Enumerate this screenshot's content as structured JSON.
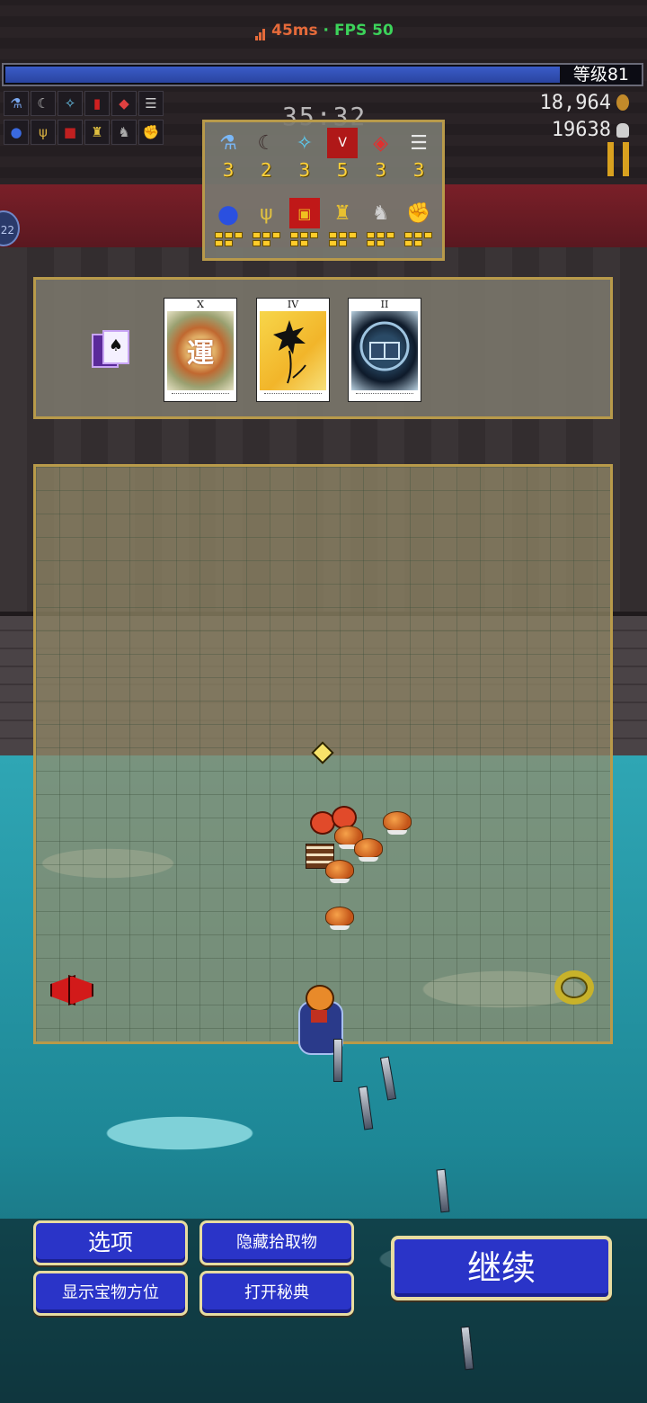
{
  "status": {
    "ping": "45ms",
    "separator": " · ",
    "fps": "FPS 50"
  },
  "xp": {
    "level_label": "等级81",
    "progress": 0.875
  },
  "timer": "35:32",
  "stats": {
    "gold": "18,964",
    "kills": "19638"
  },
  "left_badge": "22",
  "quick_icons": {
    "row1": [
      "flask-icon",
      "whip-icon",
      "wand-icon",
      "book-icon",
      "orb-icon",
      "knives-icon"
    ],
    "row2": [
      "blue-orb-icon",
      "candelabra-icon",
      "tome-icon",
      "crown-icon",
      "armor-icon",
      "gauntlet-icon"
    ]
  },
  "equipment": {
    "weapons": [
      {
        "icon": "holy-water-icon",
        "count": "3"
      },
      {
        "icon": "whip-icon",
        "count": "2"
      },
      {
        "icon": "magic-wand-icon",
        "count": "3"
      },
      {
        "icon": "king-bible-icon",
        "count": "5"
      },
      {
        "icon": "runetracer-icon",
        "count": "3"
      },
      {
        "icon": "knife-icon",
        "count": "3"
      }
    ],
    "passives": [
      {
        "icon": "blue-orb-icon",
        "level": 5
      },
      {
        "icon": "candelabrador-icon",
        "level": 5
      },
      {
        "icon": "empty-tome-icon",
        "level": 5
      },
      {
        "icon": "crown-icon",
        "level": 5
      },
      {
        "icon": "armor-icon",
        "level": 5
      },
      {
        "icon": "bracer-icon",
        "level": 5
      }
    ]
  },
  "arcana": {
    "deck_icon": "arcana-deck-icon",
    "cards": [
      {
        "numeral": "X",
        "art_text": "運"
      },
      {
        "numeral": "IV",
        "art_text": ""
      },
      {
        "numeral": "II",
        "art_text": ""
      }
    ]
  },
  "buttons": {
    "options": "选项",
    "hide_pickups": "隐藏拾取物",
    "show_treasure": "显示宝物方位",
    "open_codex": "打开秘典",
    "continue": "继续"
  },
  "colors": {
    "accent_gold": "#b89a4a",
    "button_blue": "#2a34c8",
    "fps_green": "#3cd35a",
    "ping_orange": "#e56a3a"
  }
}
